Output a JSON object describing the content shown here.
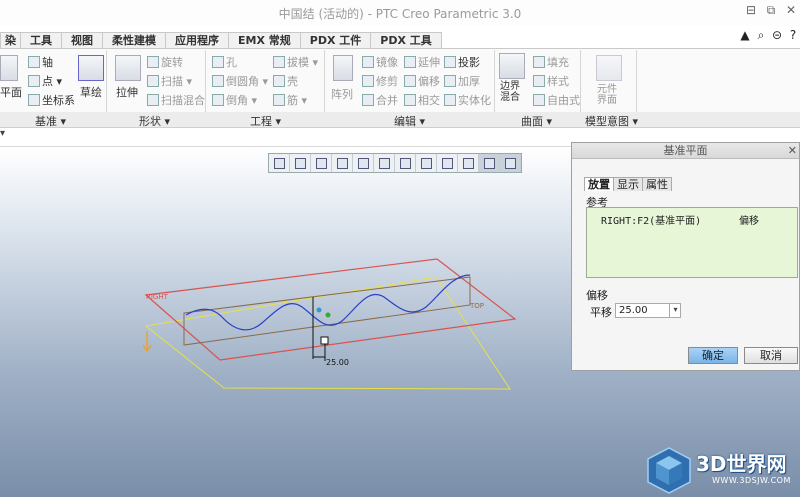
{
  "window": {
    "title": "中国结 (活动的) - PTC Creo Parametric 3.0",
    "controls": [
      "⊟",
      "⧉",
      "✕"
    ]
  },
  "tabs": [
    "染",
    "工具",
    "视图",
    "柔性建模",
    "应用程序",
    "EMX 常规",
    "PDX 工件",
    "PDX 工具"
  ],
  "top_icons": [
    "▲",
    "⌕",
    "⊝",
    "?"
  ],
  "ribbon": {
    "datum_plane": "平面",
    "axis": "轴",
    "point": "点",
    "csys": "坐标系",
    "sketch": "草绘",
    "extrude": "拉伸",
    "revolve": "旋转",
    "sweep": "扫描",
    "swept_blend": "扫描混合",
    "hole": "孔",
    "round": "倒圆角",
    "chamfer": "倒角",
    "draft": "拔模",
    "shell": "壳",
    "rib": "筋",
    "pattern": "阵列",
    "mirror": "镜像",
    "trim": "修剪",
    "merge": "合并",
    "extend": "延伸",
    "offset": "偏移",
    "intersect": "相交",
    "project": "投影",
    "thicken": "加厚",
    "solidify": "实体化",
    "boundary_blend": "边界混合",
    "fill": "填充",
    "style": "样式",
    "freestyle": "自由式",
    "component_interface": "元件界面"
  },
  "groups": [
    "基准",
    "形状",
    "工程",
    "编辑",
    "曲面",
    "模型意图"
  ],
  "viewport": {
    "dimension": "25.00",
    "label_right": "RIGHT",
    "label_top": "TOP"
  },
  "dialog": {
    "title": "基准平面",
    "tabs": [
      "放置",
      "显示",
      "属性"
    ],
    "references_label": "参考",
    "reference_name": "RIGHT:F2(基准平面)",
    "reference_type": "偏移",
    "offset_label": "偏移",
    "translate_label": "平移",
    "translate_value": "25.00",
    "ok_label": "确定",
    "cancel_label": "取消"
  },
  "watermark": {
    "brand": "3D世界网",
    "url": "WWW.3DSJW.COM"
  },
  "colors": {
    "right_plane": "#d9534f",
    "top_plane": "#8a6b4a",
    "front_plane": "#e6e04a",
    "curve": "#2b3fc8"
  }
}
